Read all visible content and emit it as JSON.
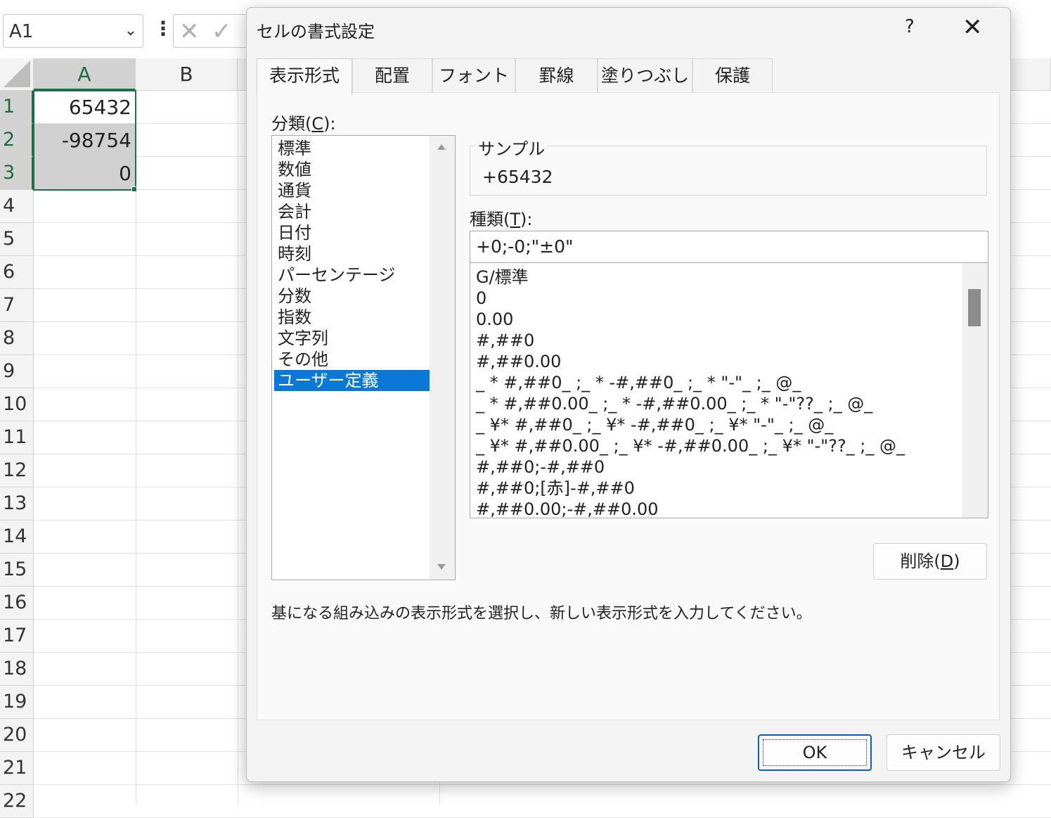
{
  "excel": {
    "namebox": "A1",
    "columns": [
      "A",
      "B"
    ],
    "rows": [
      "1",
      "2",
      "3",
      "4",
      "5",
      "6",
      "7",
      "8",
      "9",
      "10",
      "11",
      "12",
      "13",
      "14",
      "15",
      "16",
      "17",
      "18",
      "19",
      "20",
      "21",
      "22"
    ],
    "cells": {
      "a1": "65432",
      "a2": "-98754",
      "a3": "0"
    }
  },
  "dialog": {
    "title": "セルの書式設定",
    "help": "?",
    "close": "✕",
    "tabs": [
      "表示形式",
      "配置",
      "フォント",
      "罫線",
      "塗りつぶし",
      "保護"
    ],
    "category_label": "分類(",
    "category_label_key": "C",
    "category_label_end": "):",
    "categories": [
      "標準",
      "数値",
      "通貨",
      "会計",
      "日付",
      "時刻",
      "パーセンテージ",
      "分数",
      "指数",
      "文字列",
      "その他",
      "ユーザー定義"
    ],
    "selected_category": "ユーザー定義",
    "sample_label": "サンプル",
    "sample_value": "+65432",
    "type_label": "種類(",
    "type_label_key": "T",
    "type_label_end": "):",
    "type_value": "+0;-0;\"±0\"",
    "formats": [
      "G/標準",
      "0",
      "0.00",
      "#,##0",
      "#,##0.00",
      "_ * #,##0_ ;_ * -#,##0_ ;_ * \"-\"_ ;_ @_",
      "_ * #,##0.00_ ;_ * -#,##0.00_ ;_ * \"-\"??_ ;_ @_",
      "_ ¥* #,##0_ ;_ ¥* -#,##0_ ;_ ¥* \"-\"_ ;_ @_",
      "_ ¥* #,##0.00_ ;_ ¥* -#,##0.00_ ;_ ¥* \"-\"??_ ;_ @_",
      "#,##0;-#,##0",
      "#,##0;[赤]-#,##0",
      "#,##0.00;-#,##0.00"
    ],
    "delete_button": "削除(",
    "delete_key": "D",
    "delete_end": ")",
    "hint": "基になる組み込みの表示形式を選択し、新しい表示形式を入力してください。",
    "ok_button": "OK",
    "cancel_button": "キャンセル"
  },
  "colors": {
    "selection_blue": "#0b78d7",
    "excel_green": "#1e7145",
    "dialog_bg": "#f3f3f3"
  }
}
